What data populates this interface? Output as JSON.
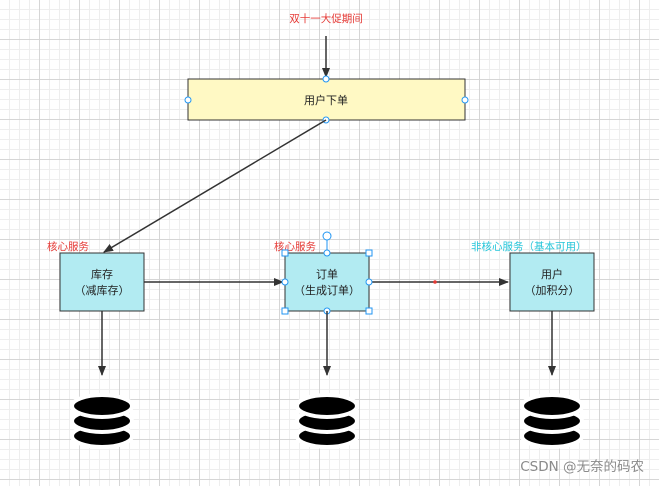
{
  "colors": {
    "order_node_fill": "#fff9c4",
    "service_node_fill": "#b2ebf2",
    "core_label": "#e53935",
    "noncore_label": "#26c6da",
    "selection_handle": "#2196f3"
  },
  "event_label": "双十一大促期间",
  "order_node": {
    "label": "用户下单"
  },
  "services": [
    {
      "tag": "核心服务",
      "line1": "库存",
      "line2": "（减库存）"
    },
    {
      "tag": "核心服务",
      "line1": "订单",
      "line2": "（生成订单）"
    },
    {
      "tag": "非核心服务（基本可用）",
      "line1": "用户",
      "line2": "（加积分）"
    }
  ],
  "database_icon": "database-icon",
  "watermark": "CSDN @无奈的码农"
}
